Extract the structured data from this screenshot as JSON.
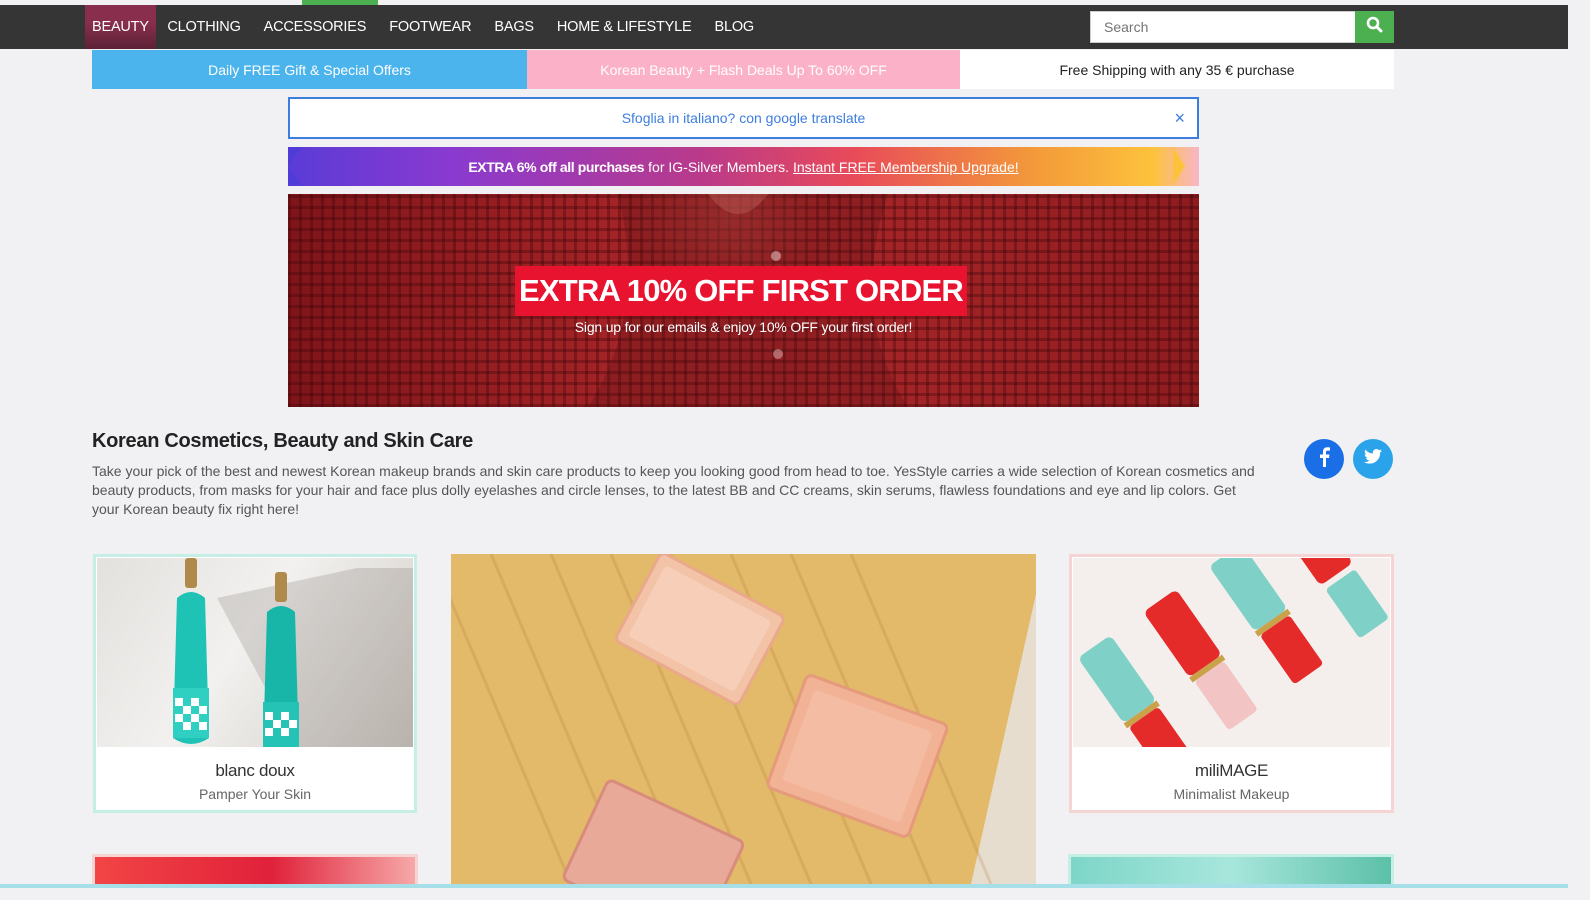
{
  "nav": {
    "items": [
      {
        "label": "BEAUTY",
        "active": true
      },
      {
        "label": "CLOTHING"
      },
      {
        "label": "ACCESSORIES"
      },
      {
        "label": "FOOTWEAR"
      },
      {
        "label": "BAGS"
      },
      {
        "label": "HOME & LIFESTYLE"
      },
      {
        "label": "BLOG"
      }
    ],
    "search_placeholder": "Search",
    "search_icon": "search-icon"
  },
  "promos": [
    {
      "label": "Daily FREE Gift & Special Offers"
    },
    {
      "label": "Korean Beauty + Flash Deals Up To 60% OFF"
    },
    {
      "label": "Free Shipping with any 35 € purchase"
    }
  ],
  "translate": {
    "text": "Sfoglia in italiano? con google translate",
    "close": "×"
  },
  "membership": {
    "strong": "EXTRA 6% off all purchases",
    "middle": "for IG-Silver Members.",
    "link": "Instant FREE Membership Upgrade!"
  },
  "hero": {
    "headline": "EXTRA 10% OFF FIRST ORDER",
    "subtitle": "Sign up for our emails & enjoy 10% OFF your first order!"
  },
  "intro": {
    "title": "Korean Cosmetics, Beauty and Skin Care",
    "text": "Take your pick of the best and newest Korean makeup brands and skin care products to keep you looking good from head to toe. YesStyle carries a wide selection of Korean cosmetics and beauty products, from masks for your hair and face plus dolly eyelashes and circle lenses, to the latest BB and CC creams, skin serums, flawless foundations and eye and lip colors. Get your Korean beauty fix right here!"
  },
  "social": [
    {
      "icon": "facebook-icon",
      "color": "#1a6fe6"
    },
    {
      "icon": "twitter-icon",
      "color": "#2ba3ea"
    }
  ],
  "tiles": [
    {
      "brand": "blanc doux",
      "tagline": "Pamper Your Skin"
    },
    {
      "brand": "miliMAGE",
      "tagline": "Minimalist Makeup"
    }
  ],
  "colors": {
    "nav_bg": "#353535",
    "accent_green": "#4caf50",
    "promo_blue": "#4bb4ec",
    "promo_pink": "#fbb2c9",
    "hero_red": "#e8132f",
    "link_blue": "#3d7de0"
  }
}
